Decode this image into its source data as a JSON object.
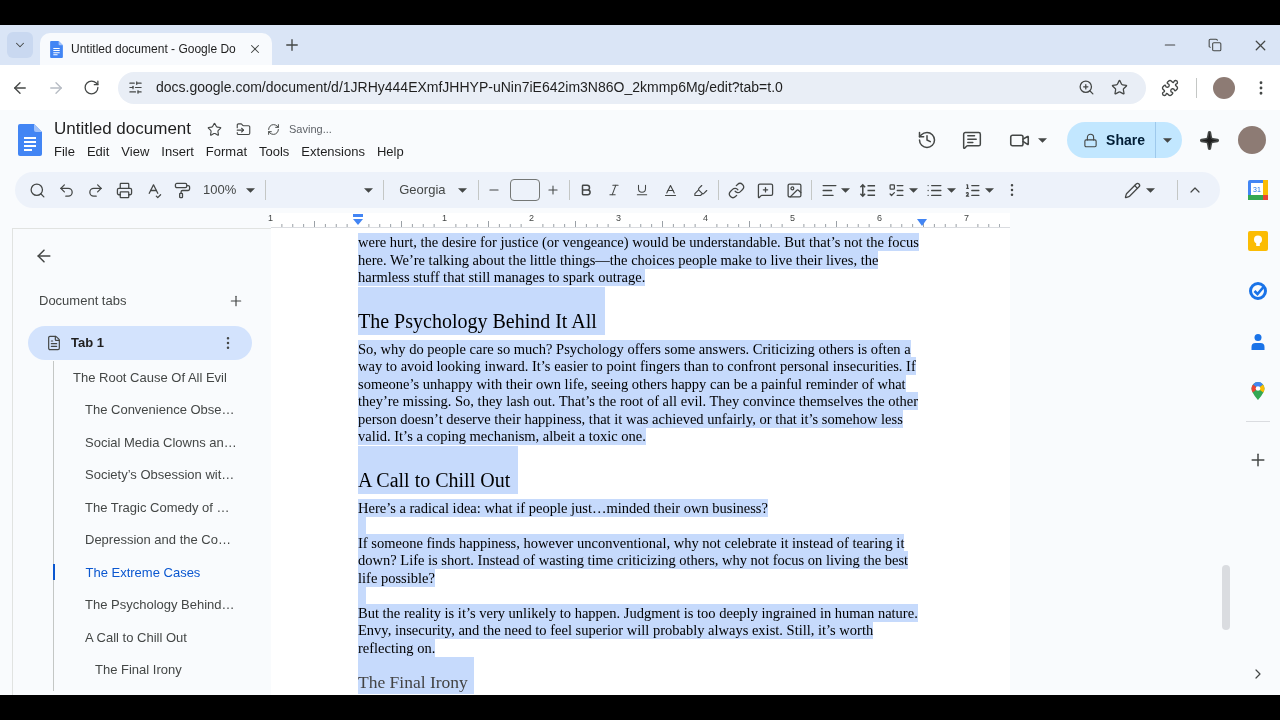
{
  "browser": {
    "tabs": [
      {
        "title": "Untitled document - Google Do",
        "selected": true
      }
    ],
    "url": "docs.google.com/document/d/1JRHy444EXmfJHHYP-uNin7iE642im3N86O_2kmmp6Mg/edit?tab=t.0",
    "forward_disabled": true
  },
  "docs": {
    "title": "Untitled document",
    "save_status": "Saving...",
    "menu": [
      "File",
      "Edit",
      "View",
      "Insert",
      "Format",
      "Tools",
      "Extensions",
      "Help"
    ],
    "share": "Share"
  },
  "toolbar": {
    "zoom": "100%",
    "font": "Georgia"
  },
  "ruler": {
    "labels": [
      "1",
      "1",
      "2",
      "3",
      "4",
      "5",
      "6",
      "7"
    ]
  },
  "sidebar": {
    "heading": "Document tabs",
    "tabs": [
      {
        "label": "Tab 1",
        "selected": true,
        "outline": [
          {
            "label": "The Root Cause Of All Evil",
            "selected": false,
            "children": [
              {
                "label": "The Convenience Obse…",
                "selected": false
              },
              {
                "label": "Social Media Clowns an…",
                "selected": false
              },
              {
                "label": "Society’s Obsession wit…",
                "selected": false
              },
              {
                "label": "The Tragic Comedy of …",
                "selected": false
              },
              {
                "label": "Depression and the Co…",
                "selected": false
              },
              {
                "label": "The Extreme Cases",
                "selected": true
              },
              {
                "label": "The Psychology Behind…",
                "selected": false
              },
              {
                "label": "A Call to Chill Out",
                "selected": false,
                "children": [
                  {
                    "label": "The Final Irony",
                    "selected": false
                  }
                ]
              }
            ]
          }
        ]
      }
    ]
  },
  "document": {
    "blocks": [
      {
        "kind": "paragraph",
        "highlighted": true,
        "text": "were hurt, the desire for justice (or vengeance) would be understandable. But that’s not the focus here. We’re talking about the little things—the choices people make to live their lives, the harmless stuff that still manages to spark outrage."
      },
      {
        "kind": "heading",
        "highlighted": true,
        "text": "The Psychology Behind It All"
      },
      {
        "kind": "paragraph",
        "highlighted": true,
        "text": "So, why do people care so much? Psychology offers some answers. Criticizing others is often a way to avoid looking inward. It’s easier to point fingers than to confront personal insecurities. If someone’s unhappy with their own life, seeing others happy can be a painful reminder of what they’re missing. So, they lash out. That’s the root of all evil. They convince themselves the other person doesn’t deserve their happiness, that it was achieved unfairly, or that it’s somehow less valid. It’s a coping mechanism, albeit a toxic one."
      },
      {
        "kind": "heading",
        "highlighted": true,
        "text": "A Call to Chill Out"
      },
      {
        "kind": "paragraph",
        "highlighted": true,
        "text": "Here’s a radical idea: what if people just…minded their own business?"
      },
      {
        "kind": "blank",
        "highlighted": true
      },
      {
        "kind": "paragraph",
        "highlighted": true,
        "text": "If someone finds happiness, however unconventional, why not celebrate it instead of tearing it down? Life is short. Instead of wasting time criticizing others, why not focus on living the best life possible?"
      },
      {
        "kind": "blank",
        "highlighted": true
      },
      {
        "kind": "paragraph",
        "highlighted": true,
        "text": "But the reality is it’s very unlikely to happen. Judgment is too deeply ingrained in human nature. Envy, insecurity, and the need to feel superior will probably always exist. Still, it’s worth reflecting on."
      },
      {
        "kind": "subheading",
        "highlighted": true,
        "text": "The Final Irony"
      }
    ]
  },
  "side_panel": {
    "calendar_day": "31"
  }
}
